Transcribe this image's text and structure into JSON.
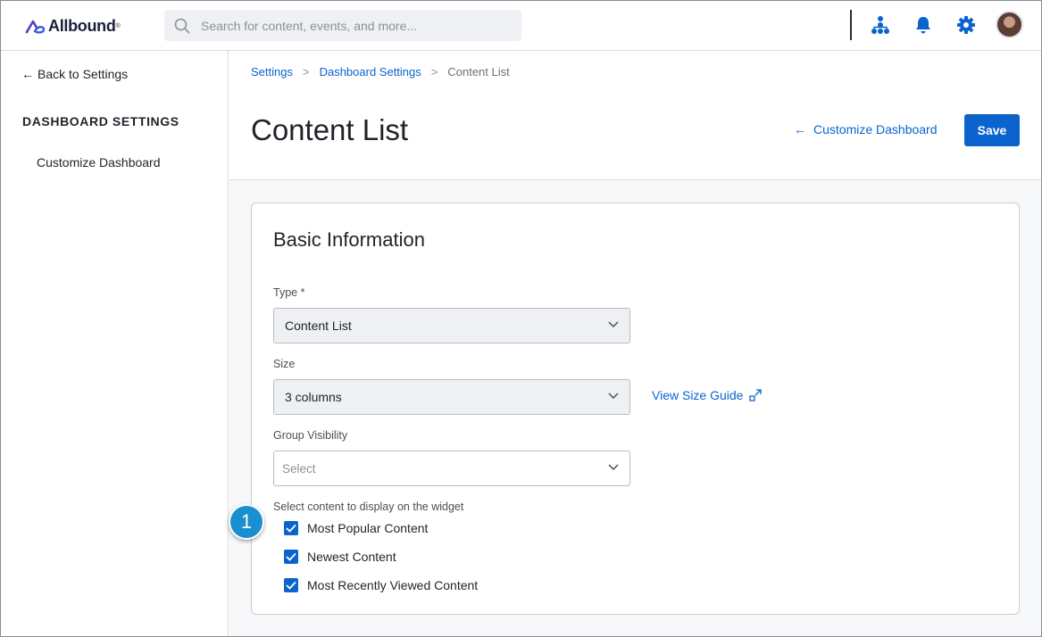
{
  "header": {
    "logo_text": "Allbound",
    "logo_mark": "®",
    "search_placeholder": "Search for content, events, and more...",
    "icons": [
      "search-icon",
      "org-chart-icon",
      "bell-icon",
      "gear-icon",
      "avatar"
    ],
    "accent_color": "#0b63ce"
  },
  "sidebar": {
    "back_label": "Back to Settings",
    "heading": "DASHBOARD SETTINGS",
    "items": [
      {
        "label": "Customize Dashboard"
      }
    ]
  },
  "breadcrumb": {
    "items": [
      {
        "label": "Settings"
      },
      {
        "label": "Dashboard Settings"
      }
    ],
    "current": "Content List"
  },
  "page": {
    "title": "Content List",
    "customize_link": "Customize Dashboard",
    "save_label": "Save"
  },
  "form": {
    "section_title": "Basic Information",
    "type": {
      "label": "Type *",
      "value": "Content List"
    },
    "size": {
      "label": "Size",
      "value": "3 columns",
      "guide_link": "View Size Guide"
    },
    "group_visibility": {
      "label": "Group Visibility",
      "placeholder": "Select"
    },
    "content_select": {
      "label": "Select content to display on the widget",
      "options": [
        {
          "label": "Most Popular Content",
          "checked": true
        },
        {
          "label": "Newest Content",
          "checked": true
        },
        {
          "label": "Most Recently Viewed Content",
          "checked": true
        }
      ]
    }
  },
  "callout": {
    "number": "1",
    "color": "#1a8fcf"
  }
}
